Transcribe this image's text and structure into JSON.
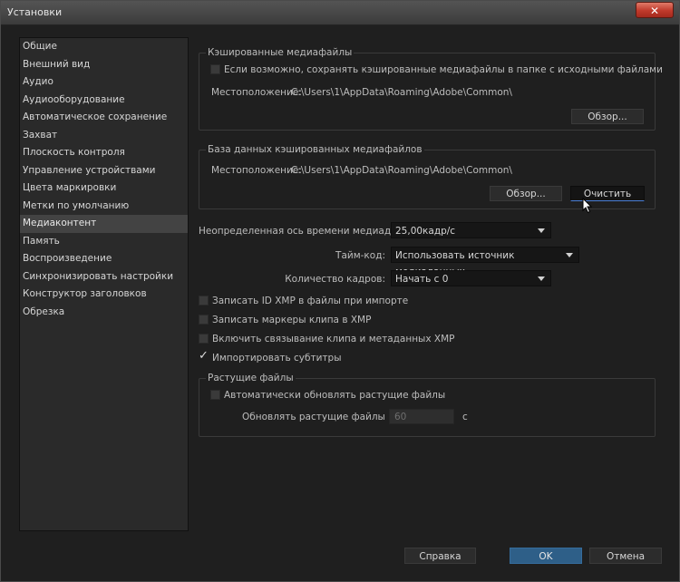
{
  "window": {
    "title": "Установки",
    "close_label": "✕"
  },
  "sidebar": {
    "items": [
      {
        "label": "Общие"
      },
      {
        "label": "Внешний вид"
      },
      {
        "label": "Аудио"
      },
      {
        "label": "Аудиооборудование"
      },
      {
        "label": "Автоматическое сохранение"
      },
      {
        "label": "Захват"
      },
      {
        "label": "Плоскость контроля"
      },
      {
        "label": "Управление устройствами"
      },
      {
        "label": "Цвета маркировки"
      },
      {
        "label": "Метки по умолчанию"
      },
      {
        "label": "Медиаконтент"
      },
      {
        "label": "Память"
      },
      {
        "label": "Воспроизведение"
      },
      {
        "label": "Синхронизировать настройки"
      },
      {
        "label": "Конструктор заголовков"
      },
      {
        "label": "Обрезка"
      }
    ],
    "selected": "Медиаконтент"
  },
  "cache_files": {
    "title": "Кэшированные медиафайлы",
    "checkbox_label": "Если возможно, сохранять кэшированные медиафайлы в папке с исходными файлами",
    "checked": false,
    "location_label": "Местоположение:",
    "location_value": "C:\\Users\\1\\AppData\\Roaming\\Adobe\\Common\\",
    "browse_label": "Обзор..."
  },
  "cache_db": {
    "title": "База данных кэшированных медиафайлов",
    "location_label": "Местоположение:",
    "location_value": "C:\\Users\\1\\AppData\\Roaming\\Adobe\\Common\\",
    "browse_label": "Обзор...",
    "clean_label": "Очистить"
  },
  "settings": {
    "timebase_label": "Неопределенная ось времени медиаданных:",
    "timebase_value": "25,00кадр/с",
    "timecode_label": "Тайм-код:",
    "timecode_value": "Использовать источник медиаданных",
    "frame_count_label": "Количество кадров:",
    "frame_count_value": "Начать с 0"
  },
  "options": [
    {
      "label": "Записать ID XMP в файлы при импорте",
      "checked": false
    },
    {
      "label": "Записать маркеры клипа в XMP",
      "checked": false
    },
    {
      "label": "Включить связывание клипа и метаданных XMP",
      "checked": false
    },
    {
      "label": "Импортировать субтитры",
      "checked": true
    }
  ],
  "growing_files": {
    "title": "Растущие файлы",
    "auto_refresh_label": "Автоматически обновлять растущие файлы",
    "auto_refresh_checked": false,
    "interval_label": "Обновлять растущие файлы раз в",
    "interval_value": "60",
    "interval_unit": "с"
  },
  "footer": {
    "help_label": "Справка",
    "ok_label": "OK",
    "cancel_label": "Отмена"
  }
}
